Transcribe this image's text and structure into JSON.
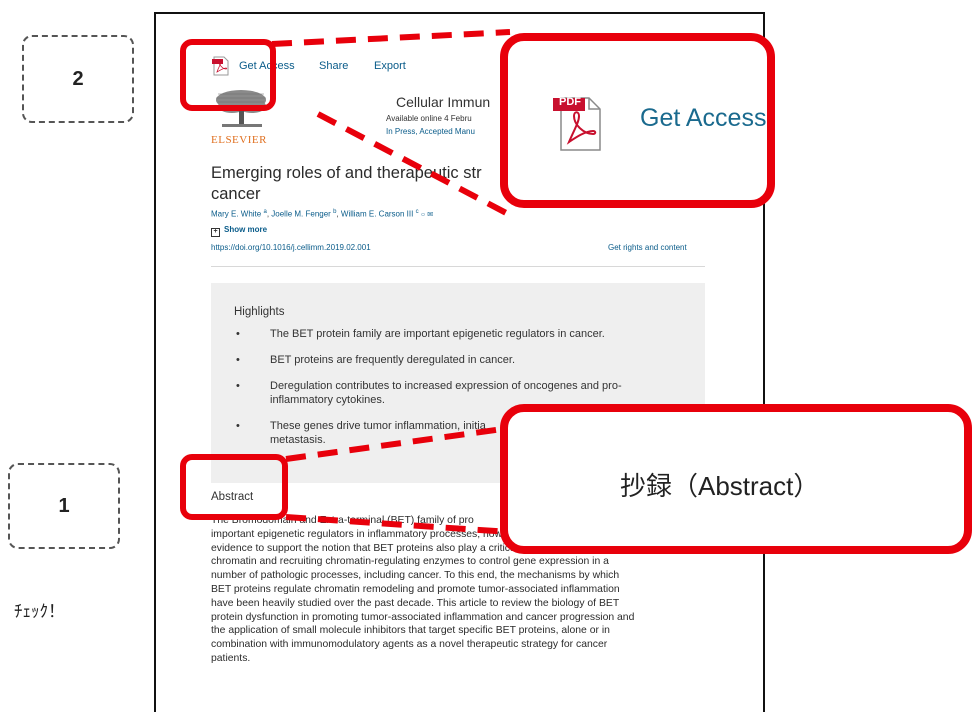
{
  "toolbar": {
    "get_access": "Get Access",
    "share": "Share",
    "export": "Export"
  },
  "journal": {
    "name": "Cellular Immun",
    "available": "Available online 4 Febru",
    "status": "In Press, Accepted Manu",
    "publisher": "ELSEVIER",
    "logo_alt_icon": "elsevier-tree-logo"
  },
  "article": {
    "title_line1": "Emerging roles of and therapeutic str",
    "title_line2": "cancer",
    "author1": "Mary E. White",
    "author1_sup": "a",
    "author2": "Joelle M. Fenger",
    "author2_sup": "b",
    "author3": "William E. Carson III",
    "author3_sup": "c",
    "show_more": "Show more",
    "doi": "https://doi.org/10.1016/j.cellimm.2019.02.001",
    "rights": "Get rights and content"
  },
  "highlights": {
    "heading": "Highlights",
    "items": [
      "The BET protein family are important epigenetic regulators in cancer.",
      "BET proteins are frequently deregulated in cancer.",
      "Deregulation contributes to increased expression of oncogenes and pro-inflammatory cytokines.",
      "These genes drive tumor inflammation, initia metastasis."
    ]
  },
  "abstract": {
    "heading": "Abstract",
    "line1": "The Bromodomain and Extra-terminal (BET) family of pro",
    "line2": "important epigenetic regulators in inflammatory processes; however, there is increasing",
    "line3": "evidence to support the notion that BET proteins also play a critical role in ‘reading’",
    "line4": "chromatin and recruiting chromatin-regulating enzymes to control gene expression in a",
    "line5": "number of pathologic processes, including cancer. To this end, the mechanisms by which",
    "line6": "BET proteins regulate chromatin remodeling and promote tumor-associated inflammation",
    "line7": "have been heavily studied over the past decade. This article to review the biology of BET",
    "line8": "protein dysfunction in promoting tumor-associated inflammation and cancer progression and",
    "line9": "the application of small molecule inhibitors that target specific BET proteins, alone or in",
    "line10": "combination with immunomodulatory agents as a novel therapeutic strategy for cancer",
    "line11": "patients."
  },
  "annotations": {
    "step2": "2",
    "step1": "1",
    "check": "ﾁｪｯｸ！",
    "callout_get_access": "Get Access",
    "callout_pdf_label": "PDF",
    "callout_abstract": "抄録（Abstract）"
  },
  "colors": {
    "annotation_red": "#e8000b",
    "link_blue": "#0a5c8a",
    "callout_blue": "#1a6a8e",
    "elsevier_orange": "#e07020",
    "highlights_bg": "#efefef"
  }
}
